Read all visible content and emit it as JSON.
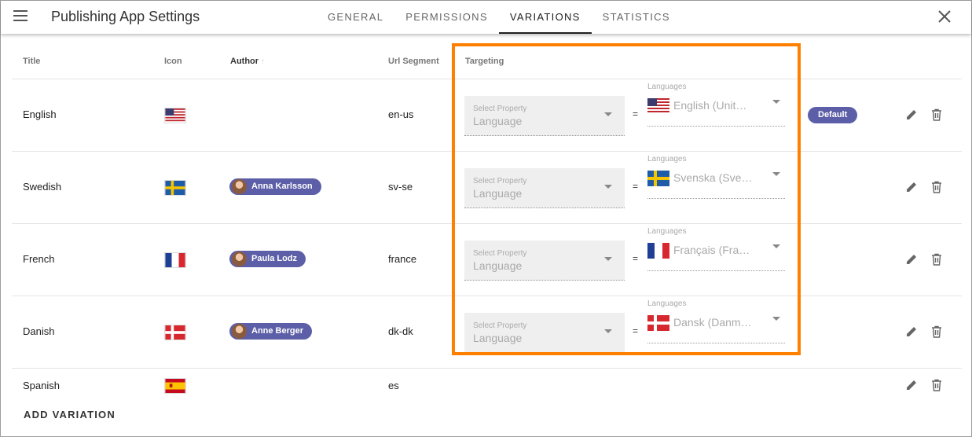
{
  "header": {
    "title": "Publishing App Settings",
    "tabs": [
      {
        "label": "GENERAL",
        "active": false
      },
      {
        "label": "PERMISSIONS",
        "active": false
      },
      {
        "label": "VARIATIONS",
        "active": true
      },
      {
        "label": "STATISTICS",
        "active": false
      }
    ]
  },
  "table": {
    "columns": {
      "title": "Title",
      "icon": "Icon",
      "author": "Author",
      "url_segment": "Url Segment",
      "targeting": "Targeting"
    },
    "rows": [
      {
        "title": "English",
        "flag": "us",
        "author": "",
        "url": "en-us",
        "property_label": "Select Property",
        "property_value": "Language",
        "operator": "=",
        "languages_label": "Languages",
        "language_value": "English (Unit…",
        "default_badge": "Default"
      },
      {
        "title": "Swedish",
        "flag": "se",
        "author": "Anna Karlsson",
        "url": "sv-se",
        "property_label": "Select Property",
        "property_value": "Language",
        "operator": "=",
        "languages_label": "Languages",
        "language_value": "Svenska (Sve…",
        "default_badge": ""
      },
      {
        "title": "French",
        "flag": "fr",
        "author": "Paula Lodz",
        "url": "france",
        "property_label": "Select Property",
        "property_value": "Language",
        "operator": "=",
        "languages_label": "Languages",
        "language_value": "Français (Fra…",
        "default_badge": ""
      },
      {
        "title": "Danish",
        "flag": "dk",
        "author": "Anne Berger",
        "url": "dk-dk",
        "property_label": "Select Property",
        "property_value": "Language",
        "operator": "=",
        "languages_label": "Languages",
        "language_value": "Dansk (Danm…",
        "default_badge": ""
      },
      {
        "title": "Spanish",
        "flag": "es",
        "author": "",
        "url": "es"
      }
    ]
  },
  "add_variation_label": "ADD VARIATION",
  "colors": {
    "accent": "#5c5fa7",
    "highlight": "#ff8000"
  },
  "icons": {
    "menu": "hamburger-menu-icon",
    "close": "close-icon",
    "edit": "pencil-edit-icon",
    "delete": "trash-delete-icon"
  }
}
